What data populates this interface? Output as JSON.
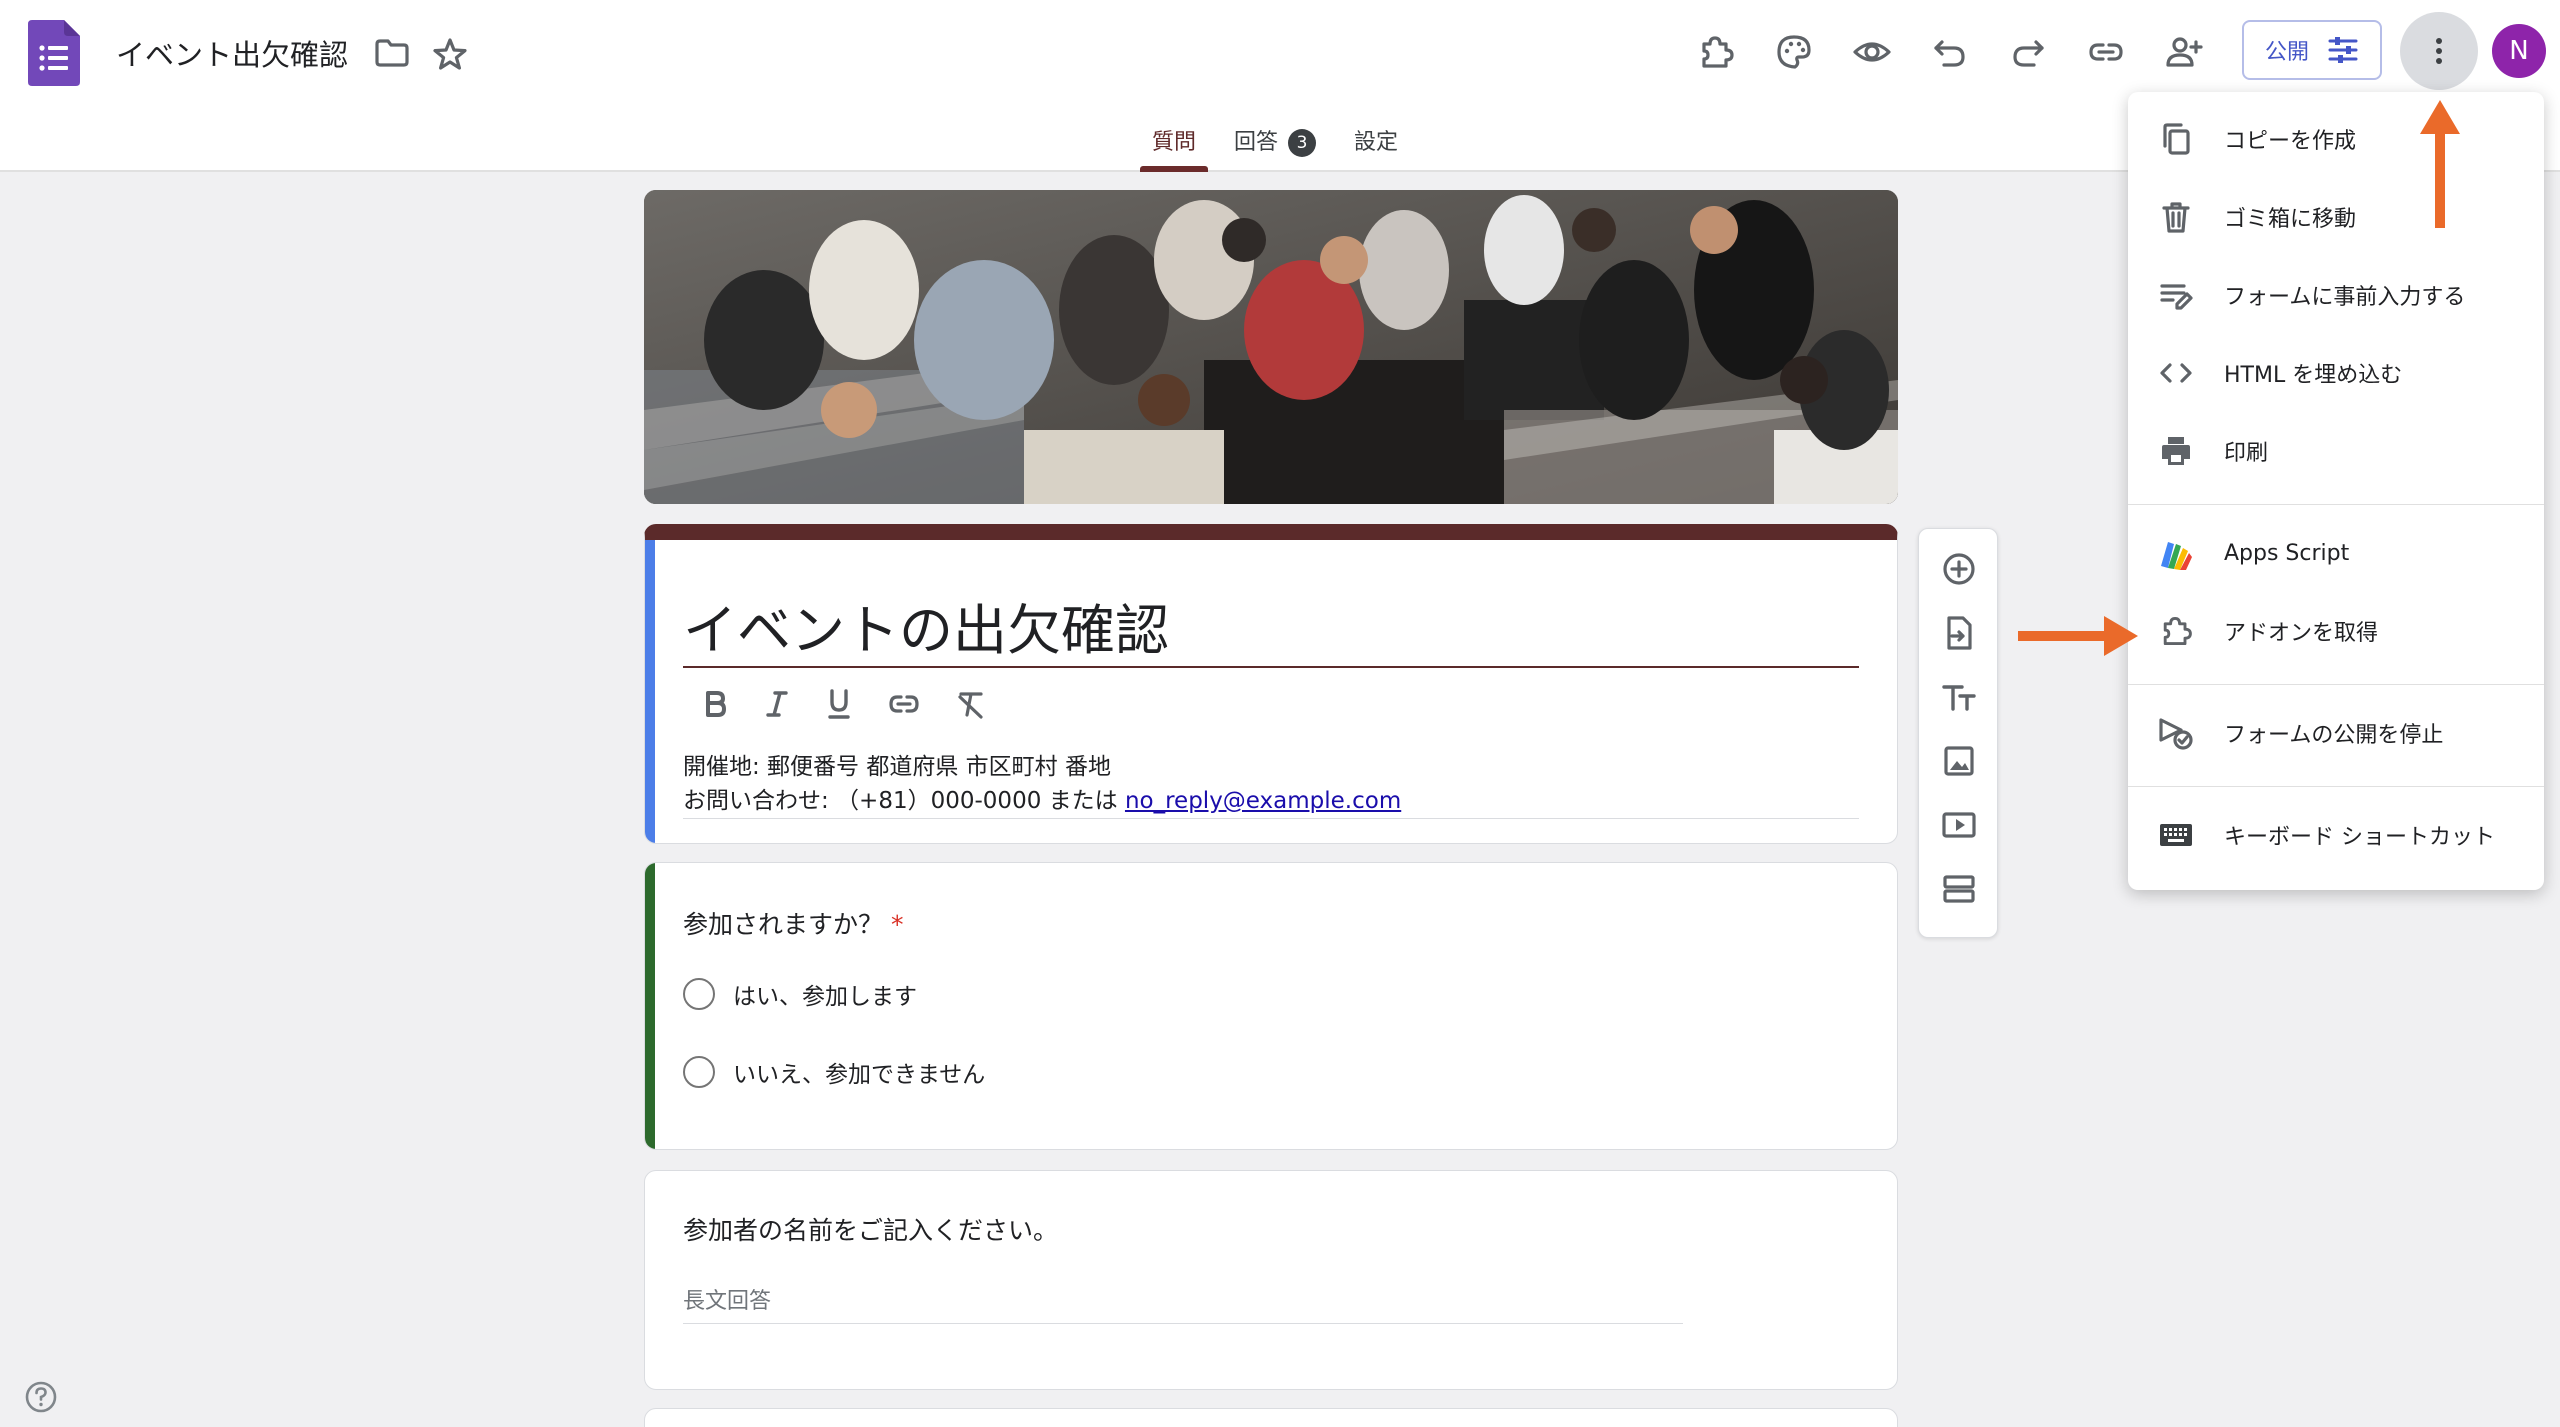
{
  "header": {
    "doc_title": "イベント出欠確認",
    "publish_label": "公開",
    "avatar_initial": "N"
  },
  "tabs": [
    {
      "label": "質問"
    },
    {
      "label": "回答",
      "badge": "3"
    },
    {
      "label": "設定"
    }
  ],
  "form": {
    "title": "イベントの出欠確認",
    "description_line1": "開催地: 郵便番号 都道府県 市区町村 番地",
    "description_line2_prefix": "お問い合わせ: （+81）000-0000 または ",
    "description_email": "no_reply@example.com"
  },
  "questions": [
    {
      "label": "参加されますか？",
      "required_mark": "*",
      "options": [
        "はい、参加します",
        "いいえ、参加できません"
      ]
    },
    {
      "label": "参加者の名前をご記入ください。",
      "answer_placeholder": "長文回答"
    }
  ],
  "menu": {
    "items": [
      {
        "label": "コピーを作成",
        "icon": "copy-icon"
      },
      {
        "label": "ゴミ箱に移動",
        "icon": "trash-icon"
      },
      {
        "label": "フォームに事前入力する",
        "icon": "prefill-icon"
      },
      {
        "label": "HTML を埋め込む",
        "icon": "code-icon"
      },
      {
        "label": "印刷",
        "icon": "print-icon"
      },
      {
        "label": "Apps Script",
        "icon": "apps-script-icon"
      },
      {
        "label": "アドオンを取得",
        "icon": "addon-icon"
      },
      {
        "label": "フォームの公開を停止",
        "icon": "unpublish-icon"
      },
      {
        "label": "キーボード ショートカット",
        "icon": "keyboard-icon"
      }
    ]
  },
  "colors": {
    "theme": "#5b2a2a",
    "accent_blue": "#4c7ee8",
    "question_accent": "#2d6a2d",
    "annotation_arrow": "#ea6a2a",
    "avatar": "#8e24aa"
  }
}
